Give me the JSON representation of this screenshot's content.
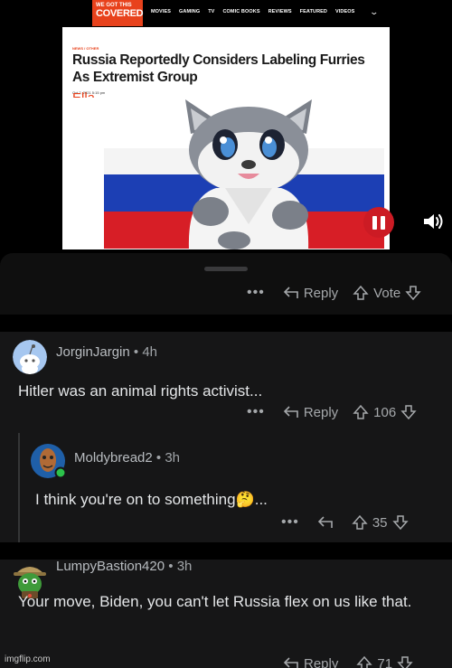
{
  "video": {
    "site_logo_line1": "WE GOT THIS",
    "site_logo_line2": "COVERED",
    "site_nav": [
      "MOVIES",
      "GAMING",
      "TV",
      "COMIC BOOKS",
      "REVIEWS",
      "FEATURED",
      "VIDEOS"
    ],
    "article_kicker": "NEWS / OTHER",
    "article_title": "Russia Reportedly Considers Labeling Furries As Extremist Group",
    "article_author": "Ella Capps",
    "article_date": "Oct 2, 2021 5:15 pm",
    "flag_colors": [
      "#f4f4f4",
      "#1c3fb4",
      "#d71e26"
    ],
    "pause_icon": "pause-icon",
    "volume_icon": "volume-icon"
  },
  "top_actions": {
    "more": "•••",
    "reply_label": "Reply",
    "vote_label": "Vote"
  },
  "comments": [
    {
      "author": "JorginJargin",
      "age": "4h",
      "text": "Hitler was an animal rights activist...",
      "more": "•••",
      "reply_label": "Reply",
      "score": "106"
    },
    {
      "author": "Moldybread2",
      "age": "3h",
      "text": "I think you're on to something",
      "emoji": "🤔",
      "text_suffix": "...",
      "more": "•••",
      "score": "35"
    },
    {
      "author": "LumpyBastion420",
      "age": "3h",
      "text": "Your move, Biden, you can't let Russia flex on us like that.",
      "reply_label": "Reply",
      "score": "71"
    }
  ],
  "separator": "•",
  "watermark": "imgflip.com"
}
